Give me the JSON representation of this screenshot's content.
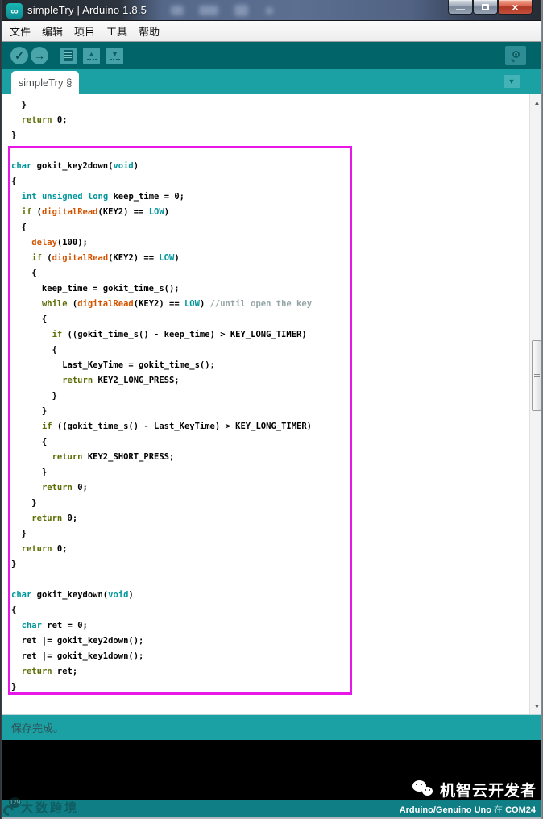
{
  "title_bar": {
    "title": "simpleTry | Arduino 1.8.5",
    "app_icon_glyph": "∞",
    "controls": {
      "minimize": "—",
      "close": "×"
    }
  },
  "menu_bar": {
    "items": [
      "文件",
      "编辑",
      "项目",
      "工具",
      "帮助"
    ]
  },
  "toolbar": {
    "verify_icon": "✓",
    "upload_icon": "→",
    "open_icon": "▲",
    "save_icon": "▼"
  },
  "tab_bar": {
    "active_tab": "simpleTry §",
    "menu_icon": "▼"
  },
  "editor": {
    "scroll_up_icon": "▲",
    "scroll_down_icon": "▼",
    "highlight_color": "#e816e8",
    "syntax_colors": {
      "plain": "#000000",
      "keyword": "#5e6d03",
      "type": "#00979c",
      "function": "#d35400",
      "comment": "#95a5a6"
    },
    "code_lines": [
      [
        [
          "p",
          "  }"
        ]
      ],
      [
        [
          "p",
          "  "
        ],
        [
          "k",
          "return"
        ],
        [
          "p",
          " 0;"
        ]
      ],
      [
        [
          "p",
          "}"
        ]
      ],
      [],
      [
        [
          "t",
          "char"
        ],
        [
          "p",
          " gokit_key2down("
        ],
        [
          "t",
          "void"
        ],
        [
          "p",
          ")"
        ]
      ],
      [
        [
          "p",
          "{"
        ]
      ],
      [
        [
          "p",
          "  "
        ],
        [
          "t",
          "int"
        ],
        [
          "p",
          " "
        ],
        [
          "t",
          "unsigned"
        ],
        [
          "p",
          " "
        ],
        [
          "t",
          "long"
        ],
        [
          "p",
          " keep_time = 0;"
        ]
      ],
      [
        [
          "p",
          "  "
        ],
        [
          "k",
          "if"
        ],
        [
          "p",
          " ("
        ],
        [
          "f",
          "digitalRead"
        ],
        [
          "p",
          "(KEY2) == "
        ],
        [
          "t",
          "LOW"
        ],
        [
          "p",
          ")"
        ]
      ],
      [
        [
          "p",
          "  {"
        ]
      ],
      [
        [
          "p",
          "    "
        ],
        [
          "f",
          "delay"
        ],
        [
          "p",
          "(100);"
        ]
      ],
      [
        [
          "p",
          "    "
        ],
        [
          "k",
          "if"
        ],
        [
          "p",
          " ("
        ],
        [
          "f",
          "digitalRead"
        ],
        [
          "p",
          "(KEY2) == "
        ],
        [
          "t",
          "LOW"
        ],
        [
          "p",
          ")"
        ]
      ],
      [
        [
          "p",
          "    {"
        ]
      ],
      [
        [
          "p",
          "      keep_time = gokit_time_s();"
        ]
      ],
      [
        [
          "p",
          "      "
        ],
        [
          "k",
          "while"
        ],
        [
          "p",
          " ("
        ],
        [
          "f",
          "digitalRead"
        ],
        [
          "p",
          "(KEY2) == "
        ],
        [
          "t",
          "LOW"
        ],
        [
          "p",
          ") "
        ],
        [
          "c",
          "//until open the key"
        ]
      ],
      [
        [
          "p",
          "      {"
        ]
      ],
      [
        [
          "p",
          "        "
        ],
        [
          "k",
          "if"
        ],
        [
          "p",
          " ((gokit_time_s() - keep_time) > KEY_LONG_TIMER)"
        ]
      ],
      [
        [
          "p",
          "        {"
        ]
      ],
      [
        [
          "p",
          "          Last_KeyTime = gokit_time_s();"
        ]
      ],
      [
        [
          "p",
          "          "
        ],
        [
          "k",
          "return"
        ],
        [
          "p",
          " KEY2_LONG_PRESS;"
        ]
      ],
      [
        [
          "p",
          "        }"
        ]
      ],
      [
        [
          "p",
          "      }"
        ]
      ],
      [
        [
          "p",
          "      "
        ],
        [
          "k",
          "if"
        ],
        [
          "p",
          " ((gokit_time_s() - Last_KeyTime) > KEY_LONG_TIMER)"
        ]
      ],
      [
        [
          "p",
          "      {"
        ]
      ],
      [
        [
          "p",
          "        "
        ],
        [
          "k",
          "return"
        ],
        [
          "p",
          " KEY2_SHORT_PRESS;"
        ]
      ],
      [
        [
          "p",
          "      }"
        ]
      ],
      [
        [
          "p",
          "      "
        ],
        [
          "k",
          "return"
        ],
        [
          "p",
          " 0;"
        ]
      ],
      [
        [
          "p",
          "    }"
        ]
      ],
      [
        [
          "p",
          "    "
        ],
        [
          "k",
          "return"
        ],
        [
          "p",
          " 0;"
        ]
      ],
      [
        [
          "p",
          "  }"
        ]
      ],
      [
        [
          "p",
          "  "
        ],
        [
          "k",
          "return"
        ],
        [
          "p",
          " 0;"
        ]
      ],
      [
        [
          "p",
          "}"
        ]
      ],
      [],
      [
        [
          "t",
          "char"
        ],
        [
          "p",
          " gokit_keydown("
        ],
        [
          "t",
          "void"
        ],
        [
          "p",
          ")"
        ]
      ],
      [
        [
          "p",
          "{"
        ]
      ],
      [
        [
          "p",
          "  "
        ],
        [
          "t",
          "char"
        ],
        [
          "p",
          " ret = 0;"
        ]
      ],
      [
        [
          "p",
          "  ret |= gokit_key2down();"
        ]
      ],
      [
        [
          "p",
          "  ret |= gokit_key1down();"
        ]
      ],
      [
        [
          "p",
          "  "
        ],
        [
          "k",
          "return"
        ],
        [
          "p",
          " ret;"
        ]
      ],
      [
        [
          "p",
          "}"
        ]
      ]
    ]
  },
  "status_bar": {
    "message": "保存完成。"
  },
  "console": {
    "text": ""
  },
  "footer": {
    "board": "Arduino/Genuino Uno",
    "preposition": "在",
    "port": "COM24"
  },
  "watermarks": {
    "bottom_left": {
      "badge": "129",
      "text": "大数跨境"
    },
    "bottom_right": {
      "text": "机智云开发者"
    }
  }
}
